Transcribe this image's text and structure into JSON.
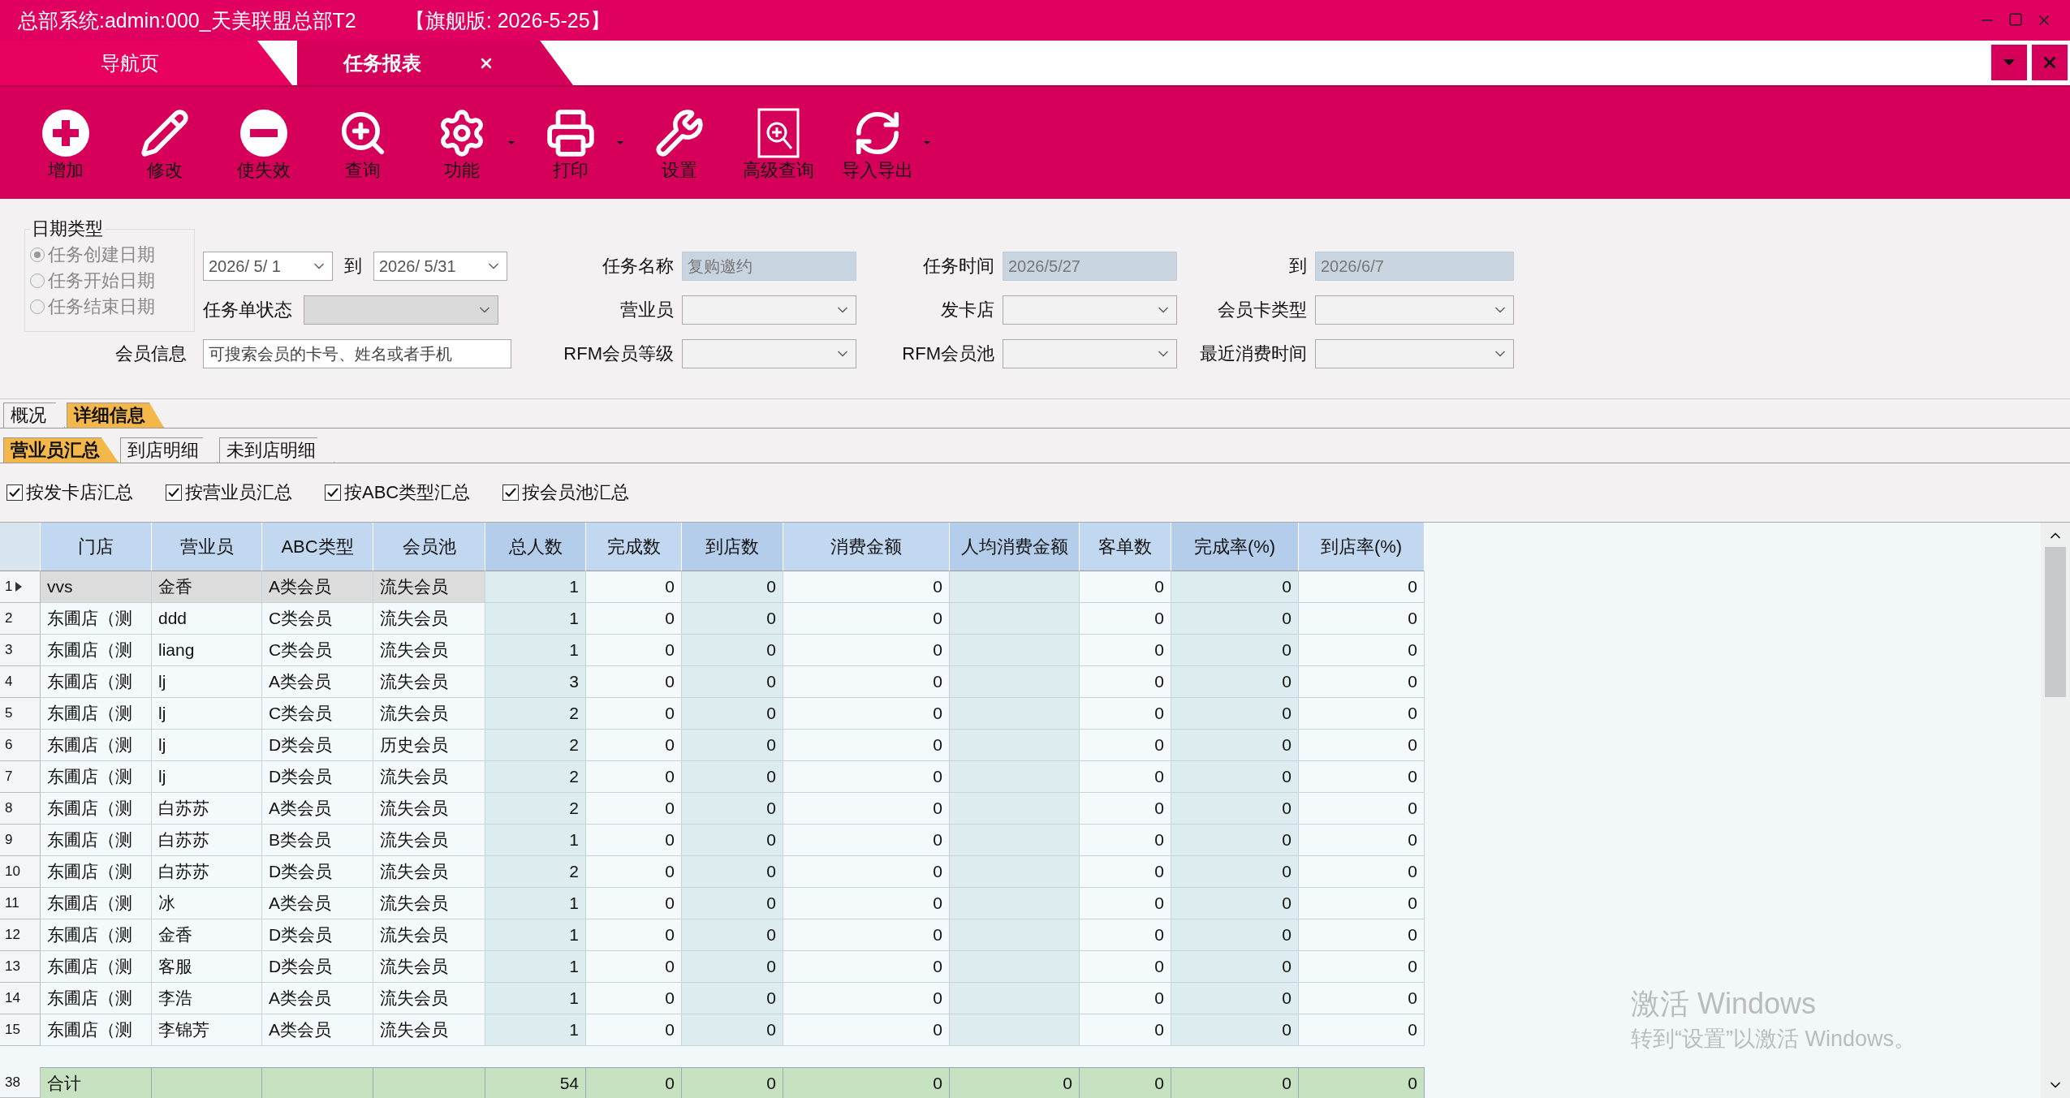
{
  "window": {
    "title": "总部系统:admin:000_天美联盟总部T2",
    "edition": "【旗舰版: 2026-5-25】"
  },
  "doc_tabs": [
    {
      "label": "导航页",
      "selected": false,
      "closable": false
    },
    {
      "label": "任务报表",
      "selected": true,
      "closable": true
    }
  ],
  "toolbar": [
    {
      "label": "增加",
      "dropdown": false
    },
    {
      "label": "修改",
      "dropdown": false
    },
    {
      "label": "使失效",
      "dropdown": false
    },
    {
      "label": "查询",
      "dropdown": false
    },
    {
      "label": "功能",
      "dropdown": true
    },
    {
      "label": "打印",
      "dropdown": true
    },
    {
      "label": "设置",
      "dropdown": false
    },
    {
      "label": "高级查询",
      "dropdown": false
    },
    {
      "label": "导入导出",
      "dropdown": true
    }
  ],
  "filters": {
    "date_type": {
      "legend": "日期类型",
      "options": [
        {
          "label": "任务创建日期",
          "selected": true
        },
        {
          "label": "任务开始日期",
          "selected": false
        },
        {
          "label": "任务结束日期",
          "selected": false
        }
      ]
    },
    "date_range": {
      "from": "2026/  5/ 1",
      "separator": "到",
      "to": "2026/  5/31"
    },
    "order_status": {
      "label": "任务单状态",
      "disabled": true
    },
    "member_info": {
      "label": "会员信息",
      "placeholder": "可搜索会员的卡号、姓名或者手机"
    },
    "fields": [
      {
        "label": "任务名称",
        "kind": "readonly",
        "value": "复购邀约"
      },
      {
        "label": "任务时间",
        "kind": "readonly",
        "value": "2026/5/27"
      },
      {
        "label": "到",
        "kind": "readonly",
        "value": "2026/6/7"
      },
      {
        "label": "营业员",
        "kind": "select"
      },
      {
        "label": "发卡店",
        "kind": "select"
      },
      {
        "label": "会员卡类型",
        "kind": "select"
      },
      {
        "label": "RFM会员等级",
        "kind": "select"
      },
      {
        "label": "RFM会员池",
        "kind": "select"
      },
      {
        "label": "最近消费时间",
        "kind": "select"
      }
    ]
  },
  "view_tabs": [
    {
      "label": "概况",
      "selected": false
    },
    {
      "label": "详细信息",
      "selected": true
    }
  ],
  "sub_tabs": [
    {
      "label": "营业员汇总",
      "selected": true
    },
    {
      "label": "到店明细",
      "selected": false
    },
    {
      "label": "未到店明细",
      "selected": false
    }
  ],
  "group_options": [
    {
      "label": "按发卡店汇总",
      "checked": true
    },
    {
      "label": "按营业员汇总",
      "checked": true
    },
    {
      "label": "按ABC类型汇总",
      "checked": true
    },
    {
      "label": "按会员池汇总",
      "checked": true
    }
  ],
  "table": {
    "columns": [
      {
        "label": "门店",
        "highlighted": false
      },
      {
        "label": "营业员",
        "highlighted": false
      },
      {
        "label": "ABC类型",
        "highlighted": false
      },
      {
        "label": "会员池",
        "highlighted": false
      },
      {
        "label": "总人数",
        "highlighted": true
      },
      {
        "label": "完成数",
        "highlighted": false
      },
      {
        "label": "到店数",
        "highlighted": true
      },
      {
        "label": "消费金额",
        "highlighted": false
      },
      {
        "label": "人均消费金额",
        "highlighted": true
      },
      {
        "label": "客单数",
        "highlighted": false
      },
      {
        "label": "完成率(%)",
        "highlighted": true
      },
      {
        "label": "到店率(%)",
        "highlighted": false
      }
    ],
    "rows": [
      {
        "number": "1",
        "selected": true,
        "cells": [
          "vvs",
          "金香",
          "A类会员",
          "流失会员",
          "1",
          "0",
          "0",
          "0",
          null,
          "0",
          "0",
          "0"
        ]
      },
      {
        "number": "2",
        "selected": false,
        "cells": [
          "东圃店（测",
          "ddd",
          "C类会员",
          "流失会员",
          "1",
          "0",
          "0",
          "0",
          null,
          "0",
          "0",
          "0"
        ]
      },
      {
        "number": "3",
        "selected": false,
        "cells": [
          "东圃店（测",
          "liang",
          "C类会员",
          "流失会员",
          "1",
          "0",
          "0",
          "0",
          null,
          "0",
          "0",
          "0"
        ]
      },
      {
        "number": "4",
        "selected": false,
        "cells": [
          "东圃店（测",
          "lj",
          "A类会员",
          "流失会员",
          "3",
          "0",
          "0",
          "0",
          null,
          "0",
          "0",
          "0"
        ]
      },
      {
        "number": "5",
        "selected": false,
        "cells": [
          "东圃店（测",
          "lj",
          "C类会员",
          "流失会员",
          "2",
          "0",
          "0",
          "0",
          null,
          "0",
          "0",
          "0"
        ]
      },
      {
        "number": "6",
        "selected": false,
        "cells": [
          "东圃店（测",
          "lj",
          "D类会员",
          "历史会员",
          "2",
          "0",
          "0",
          "0",
          null,
          "0",
          "0",
          "0"
        ]
      },
      {
        "number": "7",
        "selected": false,
        "cells": [
          "东圃店（测",
          "lj",
          "D类会员",
          "流失会员",
          "2",
          "0",
          "0",
          "0",
          null,
          "0",
          "0",
          "0"
        ]
      },
      {
        "number": "8",
        "selected": false,
        "cells": [
          "东圃店（测",
          "白苏苏",
          "A类会员",
          "流失会员",
          "2",
          "0",
          "0",
          "0",
          null,
          "0",
          "0",
          "0"
        ]
      },
      {
        "number": "9",
        "selected": false,
        "cells": [
          "东圃店（测",
          "白苏苏",
          "B类会员",
          "流失会员",
          "1",
          "0",
          "0",
          "0",
          null,
          "0",
          "0",
          "0"
        ]
      },
      {
        "number": "10",
        "selected": false,
        "cells": [
          "东圃店（测",
          "白苏苏",
          "D类会员",
          "流失会员",
          "2",
          "0",
          "0",
          "0",
          null,
          "0",
          "0",
          "0"
        ]
      },
      {
        "number": "11",
        "selected": false,
        "cells": [
          "东圃店（测",
          "冰",
          "A类会员",
          "流失会员",
          "1",
          "0",
          "0",
          "0",
          null,
          "0",
          "0",
          "0"
        ]
      },
      {
        "number": "12",
        "selected": false,
        "cells": [
          "东圃店（测",
          "金香",
          "D类会员",
          "流失会员",
          "1",
          "0",
          "0",
          "0",
          null,
          "0",
          "0",
          "0"
        ]
      },
      {
        "number": "13",
        "selected": false,
        "cells": [
          "东圃店（测",
          "客服",
          "D类会员",
          "流失会员",
          "1",
          "0",
          "0",
          "0",
          null,
          "0",
          "0",
          "0"
        ]
      },
      {
        "number": "14",
        "selected": false,
        "cells": [
          "东圃店（测",
          "李浩",
          "A类会员",
          "流失会员",
          "1",
          "0",
          "0",
          "0",
          null,
          "0",
          "0",
          "0"
        ]
      },
      {
        "number": "15",
        "selected": false,
        "cells": [
          "东圃店（测",
          "李锦芳",
          "A类会员",
          "流失会员",
          "1",
          "0",
          "0",
          "0",
          null,
          "0",
          "0",
          "0"
        ]
      }
    ],
    "total": {
      "number": "38",
      "cells": [
        "合计",
        null,
        null,
        null,
        "54",
        "0",
        "0",
        "0",
        "0",
        "0",
        "0",
        "0"
      ]
    }
  },
  "os_notice": {
    "title": "激活 Windows",
    "text": "转到“设置”以激活 Windows。"
  }
}
